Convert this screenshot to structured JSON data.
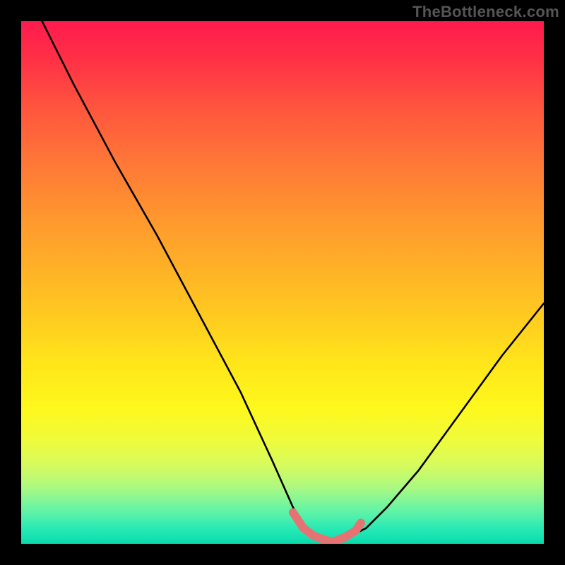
{
  "watermark": "TheBottleneck.com",
  "chart_data": {
    "type": "line",
    "title": "",
    "xlabel": "",
    "ylabel": "",
    "xlim": [
      0,
      100
    ],
    "ylim": [
      0,
      100
    ],
    "series": [
      {
        "name": "bottleneck-curve",
        "x": [
          4,
          10,
          18,
          26,
          34,
          42,
          48,
          52,
          55,
          57,
          59,
          61,
          63,
          66,
          70,
          76,
          84,
          92,
          100
        ],
        "y": [
          100,
          88,
          73,
          59,
          44,
          29,
          16,
          7,
          2,
          0.5,
          0,
          0.5,
          1.5,
          3,
          7,
          14,
          25,
          36,
          46
        ]
      }
    ],
    "highlight": {
      "name": "bottom-salmon-marker",
      "color": "#e57373",
      "x": [
        52,
        54,
        56,
        58,
        59,
        60,
        62,
        64,
        65
      ],
      "y": [
        6,
        3,
        1.5,
        0.8,
        0.5,
        0.5,
        1.3,
        2.5,
        4
      ]
    },
    "gradient_stops": [
      {
        "pos": 0,
        "color": "#ff1a4d"
      },
      {
        "pos": 50,
        "color": "#ffcf1f"
      },
      {
        "pos": 80,
        "color": "#f0fb3a"
      },
      {
        "pos": 100,
        "color": "#0bd8a8"
      }
    ]
  }
}
